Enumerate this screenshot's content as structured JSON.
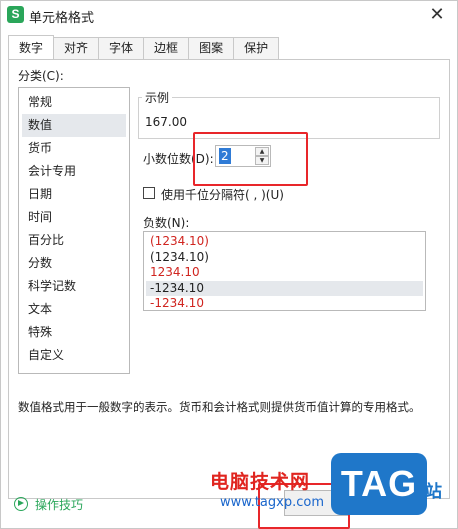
{
  "window": {
    "app_icon_letter": "S",
    "title": "单元格格式",
    "close_glyph": "✕"
  },
  "tabs": [
    {
      "label": "数字",
      "active": true
    },
    {
      "label": "对齐"
    },
    {
      "label": "字体"
    },
    {
      "label": "边框"
    },
    {
      "label": "图案"
    },
    {
      "label": "保护"
    }
  ],
  "category": {
    "label": "分类(C):",
    "items": [
      "常规",
      "数值",
      "货币",
      "会计专用",
      "日期",
      "时间",
      "百分比",
      "分数",
      "科学记数",
      "文本",
      "特殊",
      "自定义"
    ],
    "selected_index": 1
  },
  "sample": {
    "legend": "示例",
    "value": "167.00"
  },
  "decimal": {
    "label": "小数位数(D):",
    "value": "2",
    "up_glyph": "▲",
    "down_glyph": "▼"
  },
  "thousands": {
    "label": "使用千位分隔符( , )(U)",
    "checked": false
  },
  "negative": {
    "label": "负数(N):",
    "items": [
      {
        "text": "(1234.10)",
        "red": true
      },
      {
        "text": "(1234.10)",
        "red": false
      },
      {
        "text": "1234.10",
        "red": true
      },
      {
        "text": "-1234.10",
        "red": false
      },
      {
        "text": "-1234.10",
        "red": true
      }
    ],
    "selected_index": 3
  },
  "description": "数值格式用于一般数字的表示。货币和会计格式则提供货币值计算的专用格式。",
  "footer": {
    "tips_label": "操作技巧"
  },
  "watermark": {
    "site_name": "电脑技术网",
    "url": "www.tagxp.com",
    "logo": "TAG",
    "suffix": "站"
  },
  "colors": {
    "accent_green": "#2aa65a",
    "highlight_red": "#e8262a",
    "selection_blue": "#2f7bd6",
    "negative_red": "#d0241f",
    "watermark_blue": "#1f77c9"
  }
}
